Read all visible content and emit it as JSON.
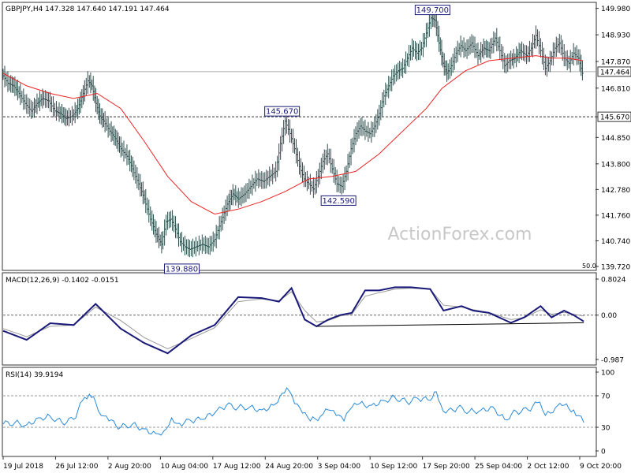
{
  "chart_data": [
    {
      "type": "line",
      "panel": "price",
      "title": "GBPJPY,H4 147.328 147.640 147.191 147.464",
      "symbol": "GBPJPY",
      "timeframe": "H4",
      "ohlc": {
        "open": 147.328,
        "high": 147.64,
        "low": 147.191,
        "close": 147.464
      },
      "chart_style": "OHLC bars",
      "ylim": [
        139.72,
        150.0
      ],
      "y_ticks": [
        "149.980",
        "148.930",
        "147.870",
        "146.810",
        "145.670",
        "144.850",
        "143.800",
        "142.780",
        "141.760",
        "140.740",
        "139.720"
      ],
      "y_tick_values": [
        149.98,
        148.93,
        147.87,
        146.81,
        145.67,
        144.85,
        143.8,
        142.78,
        141.76,
        140.74,
        139.72
      ],
      "x_ticks": [
        "19 Jul 2018",
        "26 Jul 12:00",
        "2 Aug 20:00",
        "10 Aug 04:00",
        "17 Aug 12:00",
        "24 Aug 20:00",
        "3 Sep 04:00",
        "10 Sep 12:00",
        "17 Sep 20:00",
        "25 Sep 04:00",
        "2 Oct 12:00",
        "9 Oct 20:00"
      ],
      "price_series": [
        [
          0,
          147.4
        ],
        [
          8,
          147.0
        ],
        [
          15,
          146.9
        ],
        [
          22,
          146.6
        ],
        [
          30,
          146.2
        ],
        [
          38,
          145.9
        ],
        [
          45,
          146.2
        ],
        [
          52,
          146.4
        ],
        [
          60,
          146.3
        ],
        [
          68,
          145.9
        ],
        [
          75,
          145.8
        ],
        [
          82,
          145.6
        ],
        [
          90,
          145.7
        ],
        [
          97,
          146.0
        ],
        [
          104,
          146.6
        ],
        [
          110,
          147.1
        ],
        [
          115,
          146.9
        ],
        [
          120,
          146.2
        ],
        [
          125,
          145.7
        ],
        [
          130,
          145.5
        ],
        [
          138,
          145.1
        ],
        [
          145,
          144.8
        ],
        [
          152,
          144.4
        ],
        [
          160,
          144.1
        ],
        [
          167,
          143.6
        ],
        [
          175,
          143.0
        ],
        [
          182,
          142.4
        ],
        [
          190,
          141.6
        ],
        [
          197,
          141.0
        ],
        [
          204,
          140.6
        ],
        [
          210,
          141.5
        ],
        [
          216,
          141.6
        ],
        [
          222,
          141.2
        ],
        [
          228,
          140.7
        ],
        [
          234,
          140.5
        ],
        [
          240,
          140.4
        ],
        [
          248,
          140.5
        ],
        [
          256,
          140.6
        ],
        [
          264,
          140.5
        ],
        [
          272,
          140.8
        ],
        [
          280,
          141.5
        ],
        [
          288,
          142.2
        ],
        [
          295,
          142.6
        ],
        [
          302,
          142.4
        ],
        [
          310,
          142.6
        ],
        [
          318,
          142.9
        ],
        [
          326,
          143.2
        ],
        [
          334,
          143.1
        ],
        [
          342,
          143.3
        ],
        [
          350,
          143.5
        ],
        [
          356,
          144.6
        ],
        [
          362,
          145.5
        ],
        [
          368,
          145.0
        ],
        [
          374,
          144.4
        ],
        [
          380,
          143.7
        ],
        [
          386,
          143.2
        ],
        [
          392,
          143.0
        ],
        [
          398,
          142.8
        ],
        [
          404,
          143.3
        ],
        [
          410,
          143.9
        ],
        [
          416,
          144.2
        ],
        [
          422,
          143.6
        ],
        [
          428,
          143.0
        ],
        [
          434,
          142.9
        ],
        [
          440,
          143.5
        ],
        [
          446,
          144.4
        ],
        [
          452,
          145.0
        ],
        [
          458,
          145.3
        ],
        [
          464,
          145.1
        ],
        [
          470,
          145.0
        ],
        [
          476,
          145.3
        ],
        [
          482,
          145.8
        ],
        [
          488,
          146.5
        ],
        [
          494,
          146.9
        ],
        [
          500,
          147.3
        ],
        [
          506,
          147.5
        ],
        [
          512,
          147.6
        ],
        [
          518,
          148.0
        ],
        [
          524,
          148.4
        ],
        [
          530,
          148.2
        ],
        [
          536,
          148.4
        ],
        [
          542,
          149.0
        ],
        [
          548,
          149.6
        ],
        [
          553,
          149.5
        ],
        [
          558,
          148.6
        ],
        [
          563,
          147.8
        ],
        [
          568,
          147.4
        ],
        [
          574,
          147.7
        ],
        [
          580,
          148.2
        ],
        [
          586,
          148.5
        ],
        [
          592,
          148.3
        ],
        [
          600,
          148.6
        ],
        [
          608,
          148.1
        ],
        [
          615,
          148.4
        ],
        [
          622,
          148.3
        ],
        [
          630,
          148.8
        ],
        [
          636,
          148.3
        ],
        [
          642,
          147.7
        ],
        [
          648,
          147.9
        ],
        [
          655,
          148.0
        ],
        [
          662,
          148.3
        ],
        [
          670,
          148.1
        ],
        [
          676,
          148.4
        ],
        [
          682,
          148.9
        ],
        [
          688,
          148.3
        ],
        [
          694,
          147.6
        ],
        [
          700,
          147.9
        ],
        [
          706,
          148.4
        ],
        [
          712,
          148.6
        ],
        [
          718,
          148.0
        ],
        [
          724,
          147.8
        ],
        [
          730,
          148.2
        ],
        [
          736,
          148.0
        ],
        [
          741,
          147.4
        ]
      ],
      "series": [
        {
          "name": "",
          "color": "#ee2222",
          "values": [
            [
              0,
              147.4
            ],
            [
              30,
              146.9
            ],
            [
              60,
              146.6
            ],
            [
              90,
              146.4
            ],
            [
              120,
              146.6
            ],
            [
              150,
              146.0
            ],
            [
              180,
              144.7
            ],
            [
              210,
              143.3
            ],
            [
              240,
              142.3
            ],
            [
              270,
              141.8
            ],
            [
              300,
              142.0
            ],
            [
              330,
              142.3
            ],
            [
              360,
              142.7
            ],
            [
              390,
              143.2
            ],
            [
              420,
              143.3
            ],
            [
              450,
              143.5
            ],
            [
              480,
              144.2
            ],
            [
              510,
              145.1
            ],
            [
              540,
              146.0
            ],
            [
              560,
              146.8
            ],
            [
              590,
              147.5
            ],
            [
              620,
              147.9
            ],
            [
              650,
              148.0
            ],
            [
              680,
              148.1
            ],
            [
              700,
              148.0
            ],
            [
              720,
              148.0
            ],
            [
              740,
              147.9
            ]
          ]
        }
      ],
      "annotations": [
        {
          "label": "149.700",
          "x": 548,
          "y": 149.7
        },
        {
          "label": "145.670",
          "x": 356,
          "y": 145.67
        },
        {
          "label": "142.590",
          "x": 428,
          "y": 142.59
        },
        {
          "label": "139.880",
          "x": 228,
          "y": 139.88
        }
      ],
      "reference_lines": [
        {
          "y": 145.67,
          "style": "dashed",
          "label": "145.670"
        },
        {
          "y": 147.464,
          "style": "solid",
          "label": "147.464"
        }
      ],
      "corner_label": "50.0",
      "watermark": "ActionForex.com",
      "grid": false
    },
    {
      "type": "line",
      "panel": "macd",
      "title": "MACD(12,26,9) -0.1402 -0.0151",
      "ylim": [
        -0.987,
        0.8024
      ],
      "y_ticks": [
        "0.8024",
        "0.00",
        "-0.987"
      ],
      "y_tick_values": [
        0.8024,
        0.0,
        -0.987
      ],
      "series": [
        {
          "name": "",
          "color": "#1a1a7a",
          "values": [
            [
              0,
              -0.35
            ],
            [
              30,
              -0.55
            ],
            [
              60,
              -0.18
            ],
            [
              90,
              -0.22
            ],
            [
              118,
              0.25
            ],
            [
              150,
              -0.3
            ],
            [
              180,
              -0.62
            ],
            [
              210,
              -0.85
            ],
            [
              240,
              -0.45
            ],
            [
              270,
              -0.22
            ],
            [
              300,
              0.4
            ],
            [
              330,
              0.38
            ],
            [
              352,
              0.3
            ],
            [
              368,
              0.6
            ],
            [
              385,
              -0.1
            ],
            [
              400,
              -0.25
            ],
            [
              415,
              -0.1
            ],
            [
              430,
              0.0
            ],
            [
              445,
              0.05
            ],
            [
              462,
              0.55
            ],
            [
              480,
              0.55
            ],
            [
              500,
              0.62
            ],
            [
              520,
              0.62
            ],
            [
              545,
              0.58
            ],
            [
              562,
              0.1
            ],
            [
              585,
              0.2
            ],
            [
              600,
              0.1
            ],
            [
              620,
              0.05
            ],
            [
              648,
              -0.17
            ],
            [
              665,
              -0.05
            ],
            [
              686,
              0.2
            ],
            [
              700,
              -0.05
            ],
            [
              716,
              0.1
            ],
            [
              728,
              0.0
            ],
            [
              741,
              -0.14
            ]
          ]
        },
        {
          "name": "",
          "color": "#9a9a9a",
          "values": [
            [
              0,
              -0.3
            ],
            [
              30,
              -0.48
            ],
            [
              60,
              -0.25
            ],
            [
              90,
              -0.22
            ],
            [
              118,
              0.18
            ],
            [
              150,
              -0.12
            ],
            [
              180,
              -0.5
            ],
            [
              210,
              -0.75
            ],
            [
              240,
              -0.52
            ],
            [
              270,
              -0.28
            ],
            [
              300,
              0.3
            ],
            [
              330,
              0.36
            ],
            [
              352,
              0.32
            ],
            [
              368,
              0.52
            ],
            [
              385,
              0.1
            ],
            [
              400,
              -0.15
            ],
            [
              415,
              -0.12
            ],
            [
              430,
              -0.02
            ],
            [
              445,
              0.02
            ],
            [
              462,
              0.42
            ],
            [
              480,
              0.5
            ],
            [
              500,
              0.58
            ],
            [
              520,
              0.6
            ],
            [
              545,
              0.58
            ],
            [
              562,
              0.22
            ],
            [
              585,
              0.18
            ],
            [
              600,
              0.12
            ],
            [
              620,
              0.06
            ],
            [
              648,
              -0.1
            ],
            [
              665,
              -0.06
            ],
            [
              686,
              0.12
            ],
            [
              700,
              0.02
            ],
            [
              716,
              0.06
            ],
            [
              728,
              0.02
            ],
            [
              741,
              -0.02
            ]
          ]
        }
      ],
      "trendline": [
        [
          400,
          -0.25
        ],
        [
          741,
          -0.17
        ]
      ]
    },
    {
      "type": "line",
      "panel": "rsi",
      "title": "RSI(14) 39.9194",
      "ylim": [
        0,
        100
      ],
      "y_ticks": [
        "100",
        "70",
        "30",
        "0"
      ],
      "y_tick_values": [
        100,
        70,
        30,
        0
      ],
      "reference_levels": [
        70,
        30
      ],
      "series": [
        {
          "name": "",
          "color": "#2a8ad8",
          "values": [
            [
              0,
              34
            ],
            [
              15,
              36
            ],
            [
              30,
              33
            ],
            [
              45,
              42
            ],
            [
              60,
              44
            ],
            [
              75,
              36
            ],
            [
              90,
              40
            ],
            [
              104,
              68
            ],
            [
              110,
              72
            ],
            [
              118,
              62
            ],
            [
              125,
              45
            ],
            [
              135,
              38
            ],
            [
              150,
              30
            ],
            [
              165,
              34
            ],
            [
              180,
              28
            ],
            [
              195,
              22
            ],
            [
              205,
              25
            ],
            [
              215,
              42
            ],
            [
              225,
              35
            ],
            [
              240,
              38
            ],
            [
              255,
              40
            ],
            [
              270,
              48
            ],
            [
              285,
              58
            ],
            [
              300,
              55
            ],
            [
              315,
              56
            ],
            [
              330,
              52
            ],
            [
              345,
              58
            ],
            [
              356,
              73
            ],
            [
              362,
              80
            ],
            [
              372,
              60
            ],
            [
              382,
              48
            ],
            [
              392,
              38
            ],
            [
              405,
              44
            ],
            [
              415,
              52
            ],
            [
              425,
              45
            ],
            [
              435,
              38
            ],
            [
              445,
              55
            ],
            [
              455,
              60
            ],
            [
              470,
              58
            ],
            [
              485,
              64
            ],
            [
              500,
              68
            ],
            [
              515,
              62
            ],
            [
              530,
              66
            ],
            [
              545,
              64
            ],
            [
              553,
              75
            ],
            [
              558,
              60
            ],
            [
              565,
              48
            ],
            [
              580,
              55
            ],
            [
              595,
              50
            ],
            [
              610,
              52
            ],
            [
              625,
              56
            ],
            [
              640,
              40
            ],
            [
              655,
              50
            ],
            [
              670,
              52
            ],
            [
              685,
              62
            ],
            [
              692,
              45
            ],
            [
              705,
              55
            ],
            [
              716,
              58
            ],
            [
              728,
              52
            ],
            [
              741,
              36
            ]
          ]
        }
      ]
    }
  ]
}
